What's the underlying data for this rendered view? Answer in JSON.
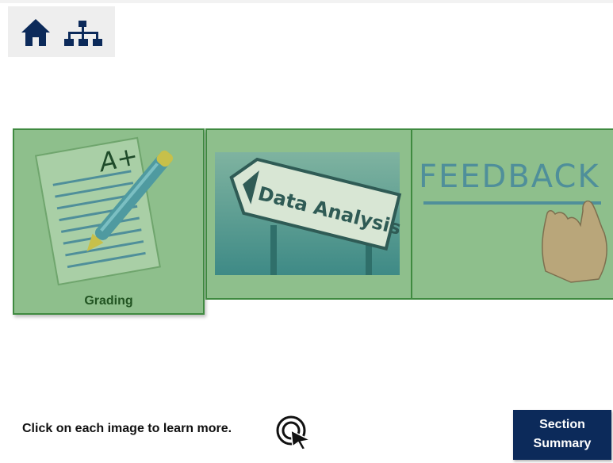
{
  "nav": {
    "home_icon": "home-icon",
    "sitemap_icon": "sitemap-icon"
  },
  "cards": {
    "grading": {
      "label": "Grading",
      "sheet_text": "A+"
    },
    "data_analysis": {
      "sign_text": "Data Analysis"
    },
    "feedback": {
      "board_text": "FEEDBACK"
    }
  },
  "instruction": "Click on each image to learn more.",
  "summary_button": {
    "line1": "Section",
    "line2": "Summary"
  },
  "colors": {
    "card_bg": "#8ebf8c",
    "card_border": "#3f8a40",
    "label_text": "#225422",
    "nav_icons": "#0c2a5a",
    "summary_bg": "#0c2a5a"
  }
}
